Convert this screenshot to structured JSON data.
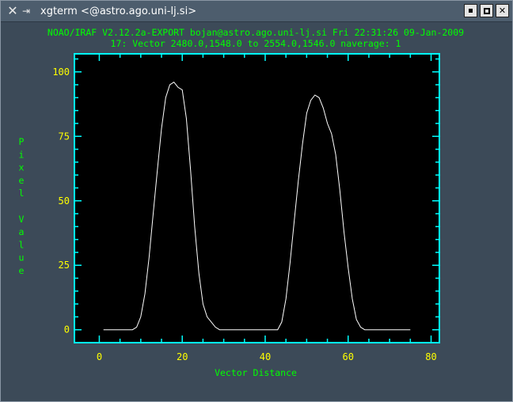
{
  "window": {
    "title": "xgterm <@astro.ago.uni-lj.si>",
    "icons": {
      "app": "x-icon",
      "pin": "pin-icon",
      "minimize": "minimize-icon",
      "maximize": "maximize-icon",
      "close": "close-icon"
    }
  },
  "plot": {
    "header_line1": "NOAO/IRAF V2.12.2a-EXPORT bojan@astro.ago.uni-lj.si Fri 22:31:26 09-Jan-2009",
    "header_line2": "17: Vector 2480.0,1548.0 to 2554.0,1546.0 naverage: 1",
    "colors": {
      "background": "#000000",
      "frame": "#00ffff",
      "line": "#ffffff",
      "labels": "#00ff00",
      "ticks": "#ffff00"
    }
  },
  "chart_data": {
    "type": "line",
    "title": "",
    "xlabel": "Vector Distance",
    "ylabel": "Pixel Value",
    "xlim": [
      -6,
      82
    ],
    "ylim": [
      -5,
      107
    ],
    "xticks": [
      0,
      20,
      40,
      60,
      80
    ],
    "yticks": [
      0,
      25,
      50,
      75,
      100
    ],
    "grid": false,
    "series": [
      {
        "x": [
          1,
          4,
          8,
          9,
          10,
          11,
          12,
          13,
          14,
          15,
          16,
          17,
          18,
          19,
          20,
          21,
          22,
          23,
          24,
          25,
          26,
          27,
          28,
          29,
          30,
          33,
          36,
          40,
          43,
          44,
          45,
          46,
          47,
          48,
          49,
          50,
          51,
          52,
          53,
          54,
          55,
          56,
          57,
          58,
          59,
          60,
          61,
          62,
          63,
          64,
          65,
          66,
          67,
          70,
          75
        ],
        "y": [
          0,
          0,
          0,
          1,
          5,
          14,
          28,
          45,
          62,
          78,
          90,
          95,
          96,
          94,
          93,
          82,
          62,
          40,
          22,
          10,
          5,
          3,
          1,
          0,
          0,
          0,
          0,
          0,
          0,
          3,
          12,
          26,
          42,
          58,
          72,
          84,
          89,
          91,
          90,
          86,
          80,
          76,
          68,
          54,
          38,
          24,
          12,
          4,
          1,
          0,
          0,
          0,
          0,
          0,
          0
        ]
      }
    ]
  }
}
